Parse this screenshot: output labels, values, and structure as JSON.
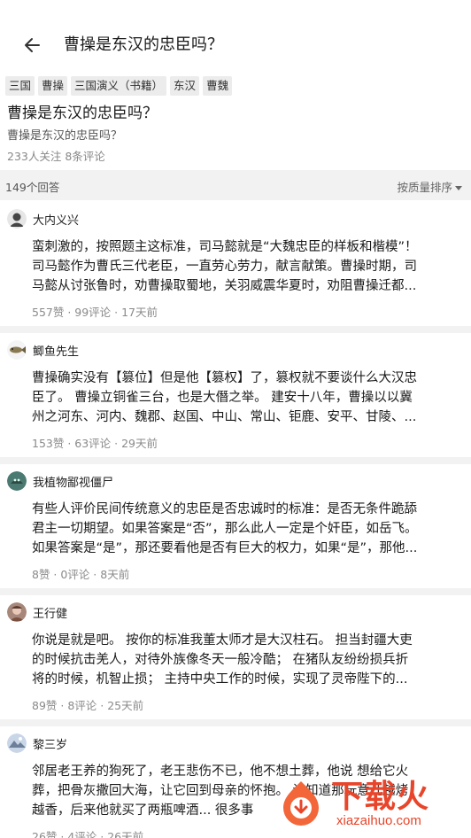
{
  "header": {
    "title": "曹操是东汉的忠臣吗？"
  },
  "tags": [
    "三国",
    "曹操",
    "三国演义（书籍）",
    "东汉",
    "曹魏"
  ],
  "question": {
    "title": "曹操是东汉的忠臣吗？",
    "description": "曹操是东汉的忠臣吗？",
    "meta": "233人关注 8条评论"
  },
  "answers_bar": {
    "count": "149个回答",
    "sort_label": "按质量排序"
  },
  "answers": [
    {
      "author": "大内义兴",
      "lines": [
        "蛮刺激的，按照题主这标准，司马懿就是“大魏忠臣的样板和楷模”！",
        "司马懿作为曹氏三代老臣，一直劳心劳力，献言献策。曹操时期，司",
        "马懿从讨张鲁时，劝曹操取蜀地，关羽威震华夏时，劝阻曹操迁都..."
      ],
      "meta": "557赞 · 99评论 · 17天前"
    },
    {
      "author": "鲫鱼先生",
      "lines": [
        "曹操确实没有【篡位】但是他【篡权】了，篡权就不要谈什么大汉忠",
        "臣了。 曹操立铜雀三台，也是大僭之举。 建安十八年，曹操以以冀",
        "州之河东、河内、魏郡、赵国、中山、常山、钜鹿、安平、甘陵、..."
      ],
      "meta": "153赞 · 63评论 · 29天前"
    },
    {
      "author": "我植物鄙视僵尸",
      "lines": [
        "有些人评价民间传统意义的忠臣是否忠诚时的标准：是否无条件跪舔",
        "君主一切期望。如果答案是“否”，那么此人一定是个奸臣，如岳飞。",
        "如果答案是“是”，那还要看他是否有巨大的权力，如果“是”，那他..."
      ],
      "meta": "8赞 · 0评论 · 8天前"
    },
    {
      "author": "王行健",
      "lines": [
        "你说是就是吧。 按你的标准我董太师才是大汉柱石。 担当封疆大吏",
        "的时候抗击羌人，对待外族像冬天一般冷酷； 在猪队友纷纷损兵折",
        "将的时候，机智止损； 主持中央工作的时候，实现了灵帝陛下的..."
      ],
      "meta": "89赞 · 8评论 · 25天前"
    },
    {
      "author": "黎三岁",
      "lines": [
        "邻居老王养的狗死了，老王悲伤不已，他不想土葬，他说 想给它火",
        "葬，把骨灰撒回大海，让它回到母亲的怀抱。 谁知道那玩意儿越烤",
        "越香，后来他就买了两瓶啤酒... 很多事"
      ],
      "meta": "26赞 · 4评论 · 26天前"
    }
  ],
  "watermark": {
    "text": "下载火",
    "url": "xiazaihuo.com"
  },
  "colors": {
    "divider": "#f2f2f2",
    "meta_text": "#8a8a8a",
    "watermark": "#e8452a"
  }
}
